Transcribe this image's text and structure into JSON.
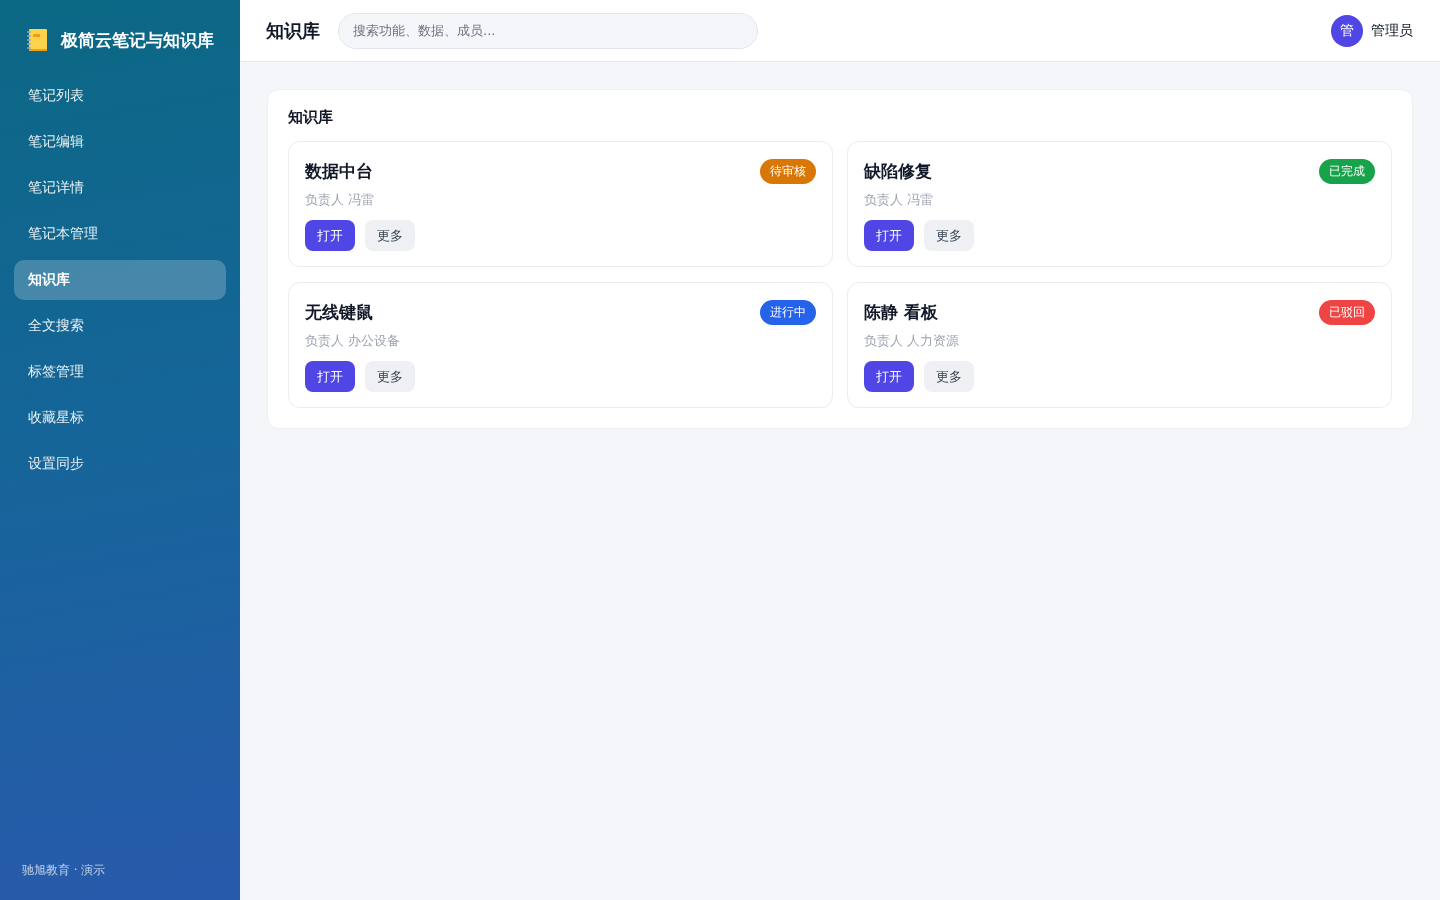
{
  "sidebar": {
    "brand": "极简云笔记与知识库",
    "items": [
      {
        "label": "笔记列表",
        "selected": false
      },
      {
        "label": "笔记编辑",
        "selected": false
      },
      {
        "label": "笔记详情",
        "selected": false
      },
      {
        "label": "笔记本管理",
        "selected": false
      },
      {
        "label": "知识库",
        "selected": true
      },
      {
        "label": "全文搜索",
        "selected": false
      },
      {
        "label": "标签管理",
        "selected": false
      },
      {
        "label": "收藏星标",
        "selected": false
      },
      {
        "label": "设置同步",
        "selected": false
      }
    ],
    "footer": "驰旭教育 · 演示"
  },
  "header": {
    "title": "知识库",
    "search": {
      "placeholder": "搜索功能、数据、成员..."
    },
    "user": {
      "avatar": "管",
      "name": "管理员"
    }
  },
  "panel": {
    "title": "知识库",
    "cards": [
      {
        "title": "数据中台",
        "status": {
          "label": "待审核",
          "color": "#d97706"
        },
        "owner": "负责人 冯雷",
        "actions": [
          {
            "label": "打开",
            "kind": "primary"
          },
          {
            "label": "更多",
            "kind": "secondary"
          }
        ]
      },
      {
        "title": "缺陷修复",
        "status": {
          "label": "已完成",
          "color": "#16a34a"
        },
        "owner": "负责人 冯雷",
        "actions": [
          {
            "label": "打开",
            "kind": "primary"
          },
          {
            "label": "更多",
            "kind": "secondary"
          }
        ]
      },
      {
        "title": "无线键鼠",
        "status": {
          "label": "进行中",
          "color": "#2563eb"
        },
        "owner": "负责人 办公设备",
        "actions": [
          {
            "label": "打开",
            "kind": "primary"
          },
          {
            "label": "更多",
            "kind": "secondary"
          }
        ]
      },
      {
        "title": "陈静 看板",
        "status": {
          "label": "已驳回",
          "color": "#ef4444"
        },
        "owner": "负责人 人力资源",
        "actions": [
          {
            "label": "打开",
            "kind": "primary"
          },
          {
            "label": "更多",
            "kind": "secondary"
          }
        ]
      }
    ]
  }
}
